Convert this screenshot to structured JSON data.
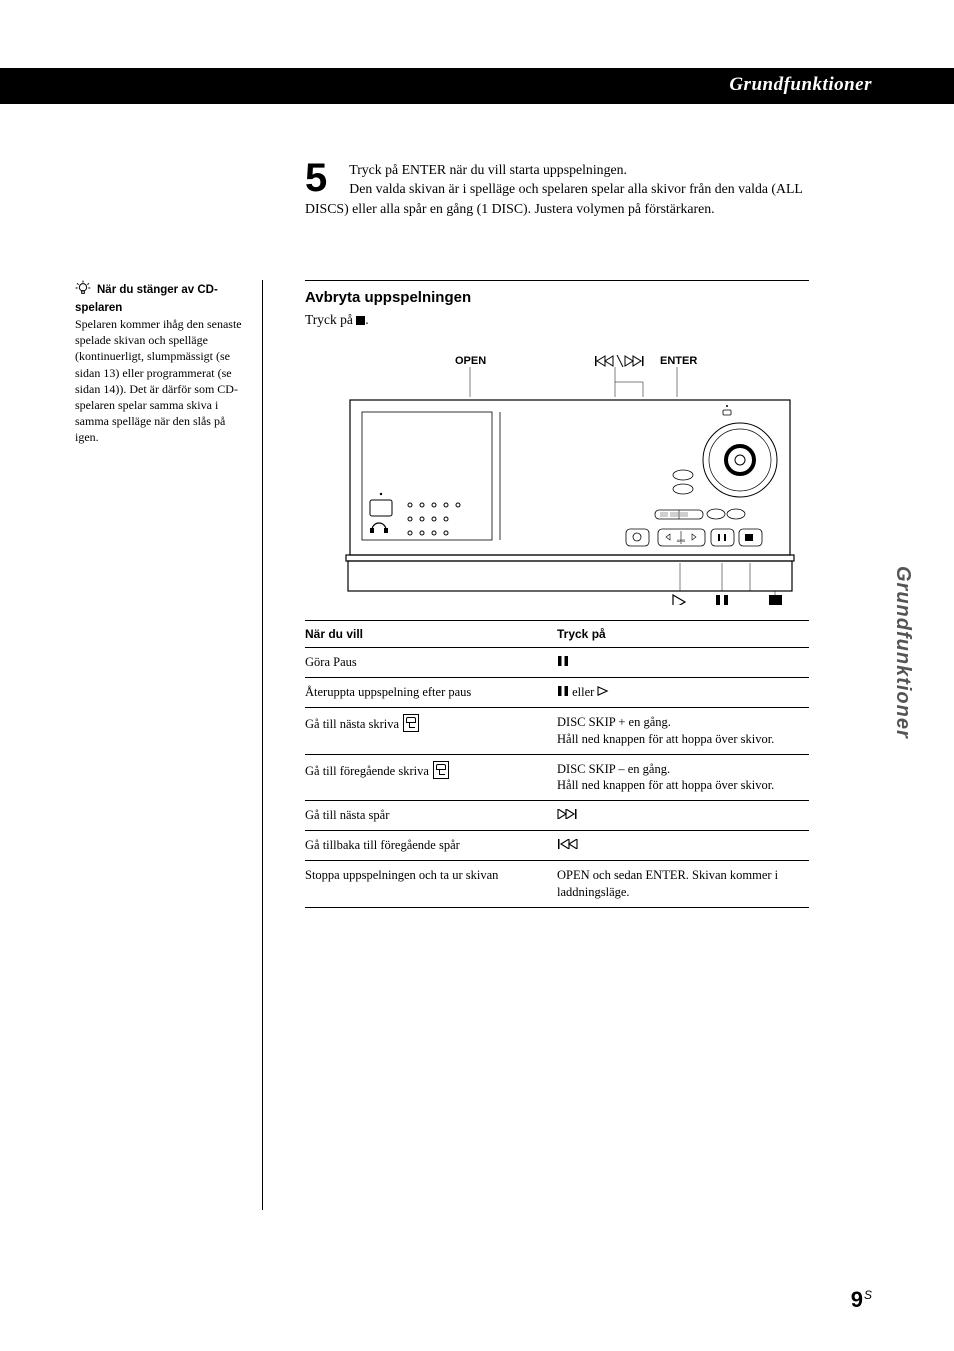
{
  "header": {
    "section": "Grundfunktioner"
  },
  "side": {
    "tab": "Grundfunktioner"
  },
  "page": {
    "number": "9",
    "suffix": "S"
  },
  "step": {
    "number": "5",
    "line1": "Tryck på ENTER när du vill starta uppspelningen.",
    "line2": "Den valda skivan är i spelläge och spelaren spelar alla skivor från den valda (ALL DISCS) eller alla spår en gång (1 DISC). Justera volymen på förstärkaren."
  },
  "tip": {
    "title": "När du stänger av CD-spelaren",
    "body": "Spelaren kommer ihåg den senaste spelade skivan och spelläge (kontinuerligt, slumpmässigt (se sidan 13) eller programmerat (se sidan 14)). Det är därför som CD-spelaren spelar samma skiva i samma spelläge när den slås på igen."
  },
  "section": {
    "heading": "Avbryta uppspelningen",
    "body_pre": "Tryck på ",
    "body_post": "."
  },
  "diagram": {
    "labels": {
      "open": "OPEN",
      "skip": "≠/±",
      "enter": "ENTER"
    }
  },
  "table": {
    "headers": {
      "when": "När du vill",
      "press": "Tryck på"
    },
    "rows": [
      {
        "when": "Göra Paus",
        "press_sym": "pause"
      },
      {
        "when": "Återuppta uppspelning efter paus",
        "press_sym": "pause-or-play"
      },
      {
        "when": "Gå till nästa skriva",
        "icon": true,
        "press": "DISC SKIP + en gång.\nHåll ned knappen för att hoppa över skivor."
      },
      {
        "when": "Gå till föregående skriva",
        "icon": true,
        "press": "DISC SKIP – en gång.\nHåll ned knappen för att hoppa över skivor."
      },
      {
        "when": "Gå till nästa spår",
        "press_sym": "next"
      },
      {
        "when": "Gå tillbaka till föregående spår",
        "press_sym": "prev"
      },
      {
        "when": "Stoppa uppspelningen och ta ur skivan",
        "press": "OPEN och sedan ENTER. Skivan kommer i laddningsläge."
      }
    ]
  }
}
